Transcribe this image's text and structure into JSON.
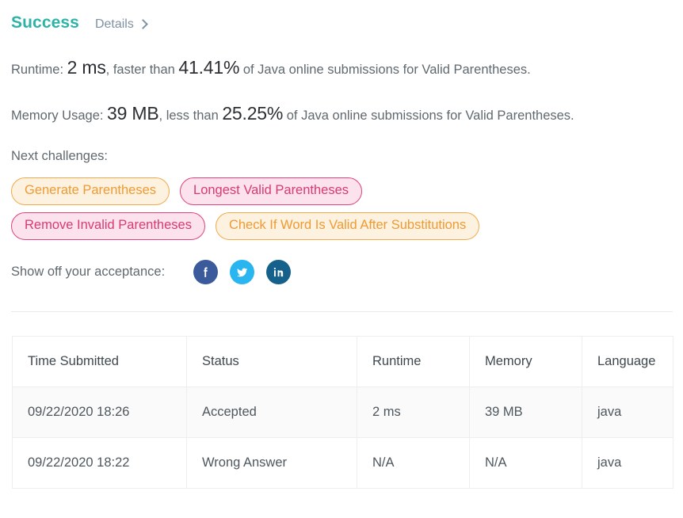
{
  "header": {
    "status": "Success",
    "details_label": "Details",
    "chevron_icon": "chevron-right-icon"
  },
  "stats": {
    "runtime": {
      "label": "Runtime:",
      "value": "2 ms",
      "middle": ", faster than",
      "percent": "41.41%",
      "suffix": "of Java online submissions for Valid Parentheses."
    },
    "memory": {
      "label": "Memory Usage:",
      "value": "39 MB",
      "middle": ", less than",
      "percent": "25.25%",
      "suffix": "of Java online submissions for Valid Parentheses."
    }
  },
  "next_challenges": {
    "label": "Next challenges:",
    "rows": [
      [
        {
          "label": "Generate Parentheses",
          "difficulty": "medium"
        },
        {
          "label": "Longest Valid Parentheses",
          "difficulty": "hard"
        }
      ],
      [
        {
          "label": "Remove Invalid Parentheses",
          "difficulty": "hard"
        },
        {
          "label": "Check If Word Is Valid After Substitutions",
          "difficulty": "medium"
        }
      ]
    ]
  },
  "share": {
    "label": "Show off your acceptance:",
    "items": [
      {
        "name": "facebook-icon",
        "network": "facebook"
      },
      {
        "name": "twitter-icon",
        "network": "twitter"
      },
      {
        "name": "linkedin-icon",
        "network": "linkedin"
      }
    ]
  },
  "table": {
    "headers": [
      "Time Submitted",
      "Status",
      "Runtime",
      "Memory",
      "Language"
    ],
    "rows": [
      {
        "time": "09/22/2020 18:26",
        "status": "Accepted",
        "status_state": "accepted",
        "runtime": "2 ms",
        "memory": "39 MB",
        "language": "java"
      },
      {
        "time": "09/22/2020 18:22",
        "status": "Wrong Answer",
        "status_state": "wrong",
        "runtime": "N/A",
        "memory": "N/A",
        "language": "java"
      }
    ]
  },
  "colors": {
    "success_teal": "#2cb3a6",
    "accepted_teal": "#2d9b92",
    "wrong_red": "#cf4a40",
    "medium_orange": "#ef9b33",
    "hard_pink": "#d93a73",
    "facebook_blue": "#3b5a9b",
    "twitter_blue": "#29b5f0",
    "linkedin_blue": "#15618c"
  }
}
